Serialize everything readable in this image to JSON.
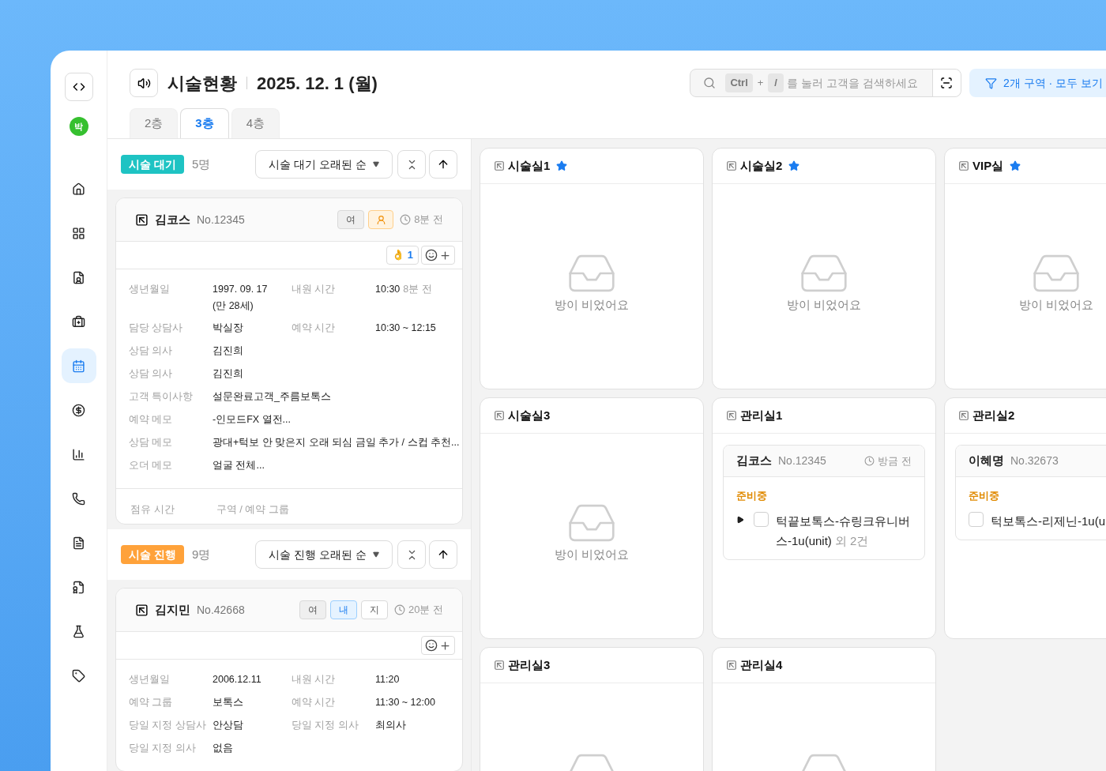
{
  "sidebar": {
    "avatar": "박",
    "items": [
      {
        "selected": false
      },
      {
        "selected": false
      },
      {
        "selected": false
      },
      {
        "selected": false
      },
      {
        "selected": true
      },
      {
        "selected": false
      },
      {
        "selected": false
      },
      {
        "selected": false
      },
      {
        "selected": false
      },
      {
        "selected": false
      },
      {
        "selected": false
      },
      {
        "selected": false
      }
    ]
  },
  "header": {
    "title": "시술현황",
    "date": "2025. 12. 1 (월)",
    "search": {
      "keys": [
        "Ctrl",
        "/"
      ],
      "joiner": "+",
      "placeholder": "를 눌러 고객을 검색하세요"
    },
    "filter": "2개 구역 · 모두 보기"
  },
  "tabs": [
    {
      "label": "2층",
      "selected": false
    },
    {
      "label": "3층",
      "selected": true
    },
    {
      "label": "4층",
      "selected": false
    }
  ],
  "sections": [
    {
      "badge": "시술 대기",
      "color": "#1ec3c3",
      "count": "5명",
      "sort": "시술 대기 오래된 순",
      "cards": [
        {
          "name": "김코스",
          "number": "No.12345",
          "tags": [
            {
              "kind": "text",
              "label": "여",
              "color": "#efefef"
            },
            {
              "kind": "icon",
              "color": "#fff3e0"
            }
          ],
          "time": "8분 전",
          "reactions": [
            {
              "emoji": "👌",
              "count": "1"
            }
          ],
          "details": [
            [
              {
                "label": "생년월일",
                "value": "1997. 09. 17",
                "line2": "(만 28세)"
              },
              {
                "label": "내원 시간",
                "value": "10:30",
                "note": "8분 전"
              }
            ],
            [
              {
                "label": "담당 상담사",
                "value": "박실장"
              },
              {
                "label": "예약 시간",
                "value": "10:30 ~ 12:15"
              }
            ],
            [
              {
                "label": "상담 의사",
                "value": "김진희"
              }
            ],
            [
              {
                "label": "상담 의사",
                "value": "김진희"
              }
            ],
            [
              {
                "label": "고객 특이사항",
                "value": "설문완료고객_주름보톡스"
              }
            ],
            [
              {
                "label": "예약 메모",
                "value": "-인모드FX 열전..."
              }
            ],
            [
              {
                "label": "상담 메모",
                "value": "광대+턱보 안 맞은지 오래 되심 금일 추가 / 스컵 추천..."
              }
            ],
            [
              {
                "label": "오더 메모",
                "value": "얼굴 전체..."
              }
            ]
          ],
          "footer": [
            "점유 시간",
            "구역 / 예약 그룹"
          ]
        }
      ]
    },
    {
      "badge": "시술 진행",
      "color": "#ffa23a",
      "count": "9명",
      "sort": "시술 진행 오래된 순",
      "cards": [
        {
          "name": "김지민",
          "number": "No.42668",
          "tags": [
            {
              "kind": "text",
              "label": "여",
              "color": "#efefef"
            },
            {
              "kind": "text",
              "label": "내",
              "color": "#e6f3ff"
            },
            {
              "kind": "text",
              "label": "지",
              "color": "#ffffff"
            }
          ],
          "time": "20분 전",
          "details": [
            [
              {
                "label": "생년월일",
                "value": "2006.12.11"
              },
              {
                "label": "내원 시간",
                "value": "11:20"
              }
            ],
            [
              {
                "label": "예약 그룹",
                "value": "보톡스"
              },
              {
                "label": "예약 시간",
                "value": "11:30 ~ 12:00"
              }
            ],
            [
              {
                "label": "당일 지정 상담사",
                "value": "안상담"
              },
              {
                "label": "당일 지정 의사",
                "value": "최의사"
              }
            ],
            [
              {
                "label": "당일 지정 의사",
                "value": "없음"
              }
            ]
          ]
        }
      ]
    }
  ],
  "rooms": [
    {
      "name": "시술실1",
      "starred": true,
      "kind": "empty",
      "empty_text": "방이 비었어요"
    },
    {
      "name": "시술실2",
      "starred": true,
      "kind": "empty",
      "empty_text": "방이 비었어요"
    },
    {
      "name": "VIP실",
      "starred": true,
      "kind": "empty",
      "empty_text": "방이 비었어요"
    },
    {
      "name": "시술실3",
      "starred": false,
      "kind": "empty",
      "empty_text": "방이 비었어요"
    },
    {
      "name": "관리실1",
      "starred": false,
      "kind": "occupied",
      "patient": {
        "name": "김코스",
        "number": "No.12345",
        "time": "방금 전",
        "status": "준비중",
        "items": [
          {
            "text": "턱끝보톡스-슈링크유니버스-1u(unit)",
            "extra": "외 2건",
            "checked": false,
            "expanded": false
          }
        ]
      }
    },
    {
      "name": "관리실2",
      "starred": false,
      "kind": "occupied",
      "patient": {
        "name": "이혜명",
        "number": "No.32673",
        "status": "준비중",
        "items": [
          {
            "text": "턱보톡스-리제닌-1u(u",
            "checked": false
          }
        ]
      }
    },
    {
      "name": "관리실3",
      "starred": false,
      "kind": "empty"
    },
    {
      "name": "관리실4",
      "starred": false,
      "kind": "empty"
    }
  ]
}
